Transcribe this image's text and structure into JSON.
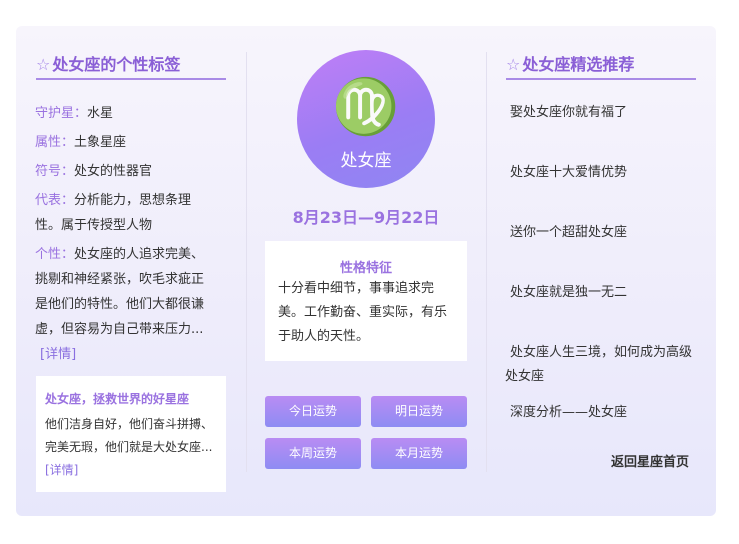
{
  "left": {
    "title": "处女座的个性标签",
    "title_star": "☆",
    "attrs": [
      {
        "label": "守护星：",
        "value": "水星"
      },
      {
        "label": "属性：",
        "value": "土象星座"
      },
      {
        "label": "符号：",
        "value": "处女的性器官"
      },
      {
        "label": "代表：",
        "value": "分析能力，思想条理性。属于传授型人物"
      },
      {
        "label": "个性：",
        "value": "处女座的人追求完美、挑剔和神经紧张，吹毛求疵正是他们的特性。他们大都很谦虚，但容易为自己带来压力...",
        "link": "[详情]"
      }
    ],
    "note": {
      "title": "处女座，拯救世界的好星座",
      "body": "他们洁身自好，他们奋斗拼搏、完美无瑕，他们就是大处女座...",
      "link": "[详情]"
    }
  },
  "center": {
    "glyph": "♍",
    "name": "处女座",
    "dates": "8月23日—9月22日",
    "trait_title": "性格特征",
    "trait_body": "十分看中细节，事事追求完美。工作勤奋、重实际，有乐于助人的天性。",
    "buttons": [
      "今日运势",
      "明日运势",
      "本周运势",
      "本月运势"
    ]
  },
  "right": {
    "title": "处女座精选推荐",
    "title_star": "☆",
    "items": [
      "娶处女座你就有福了",
      "处女座十大爱情优势",
      "送你一个超甜处女座",
      "处女座就是独一无二",
      "处女座人生三境，如何成为高级处女座",
      "深度分析——处女座"
    ],
    "back_link": "返回星座首页"
  },
  "colors": {
    "accent": "#9a72e0",
    "button_start": "#b98cf3",
    "button_end": "#8e8cf3"
  }
}
